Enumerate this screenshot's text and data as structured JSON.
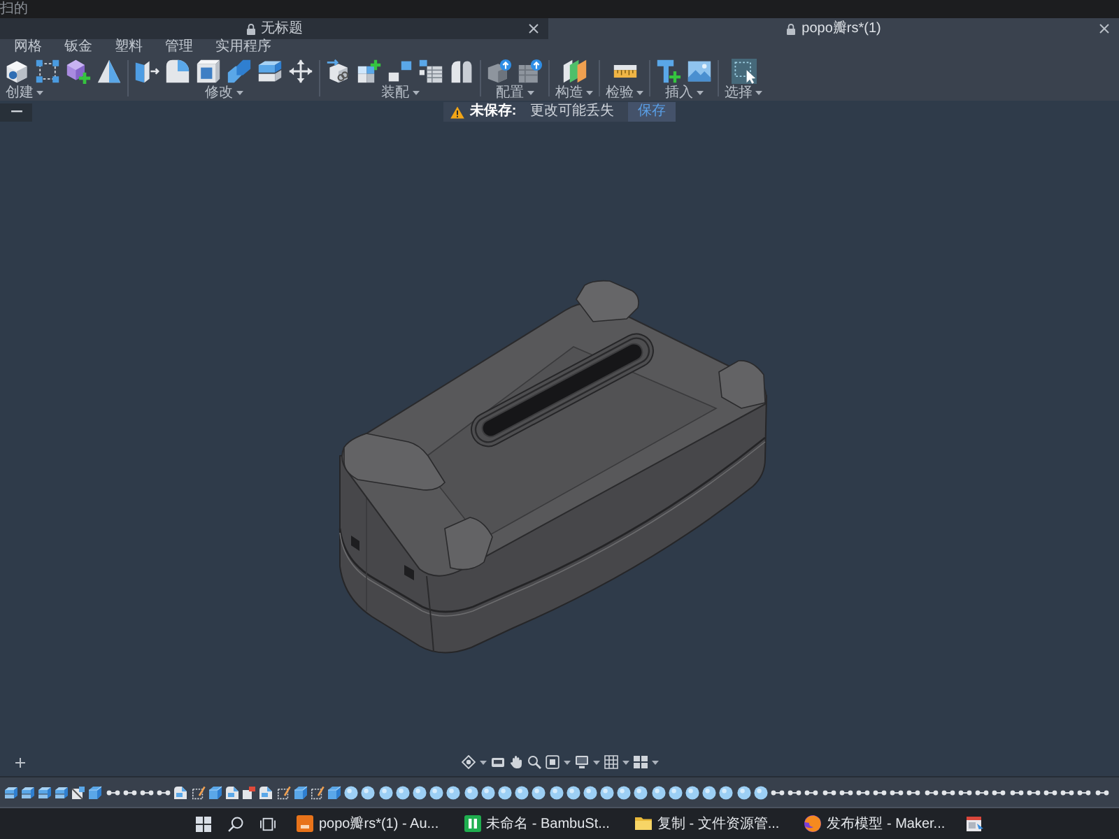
{
  "app_bar": {
    "title": "扫的"
  },
  "document_tabs": [
    {
      "title": "无标题",
      "selected": false
    },
    {
      "title": "popo瓣rs*(1)",
      "selected": true
    }
  ],
  "ribbon": {
    "tabs": [
      {
        "label": "网格",
        "selected": false
      },
      {
        "label": "钣金",
        "selected": false
      },
      {
        "label": "塑料",
        "selected": false
      },
      {
        "label": "管理",
        "selected": false
      },
      {
        "label": "实用程序",
        "selected": false
      }
    ],
    "groups": [
      {
        "label": "创建"
      },
      {
        "label": "修改"
      },
      {
        "label": "装配"
      },
      {
        "label": "配置"
      },
      {
        "label": "构造"
      },
      {
        "label": "检验"
      },
      {
        "label": "插入"
      },
      {
        "label": "选择"
      }
    ]
  },
  "notice": {
    "title": "未保存:",
    "message": "更改可能丢失",
    "button": "保存"
  },
  "taskbar": {
    "apps": [
      {
        "label": "popo瓣rs*(1) - Au..."
      },
      {
        "label": "未命名 - BambuSt..."
      },
      {
        "label": "复制 - 文件资源管..."
      },
      {
        "label": "发布模型 - Maker..."
      }
    ]
  }
}
